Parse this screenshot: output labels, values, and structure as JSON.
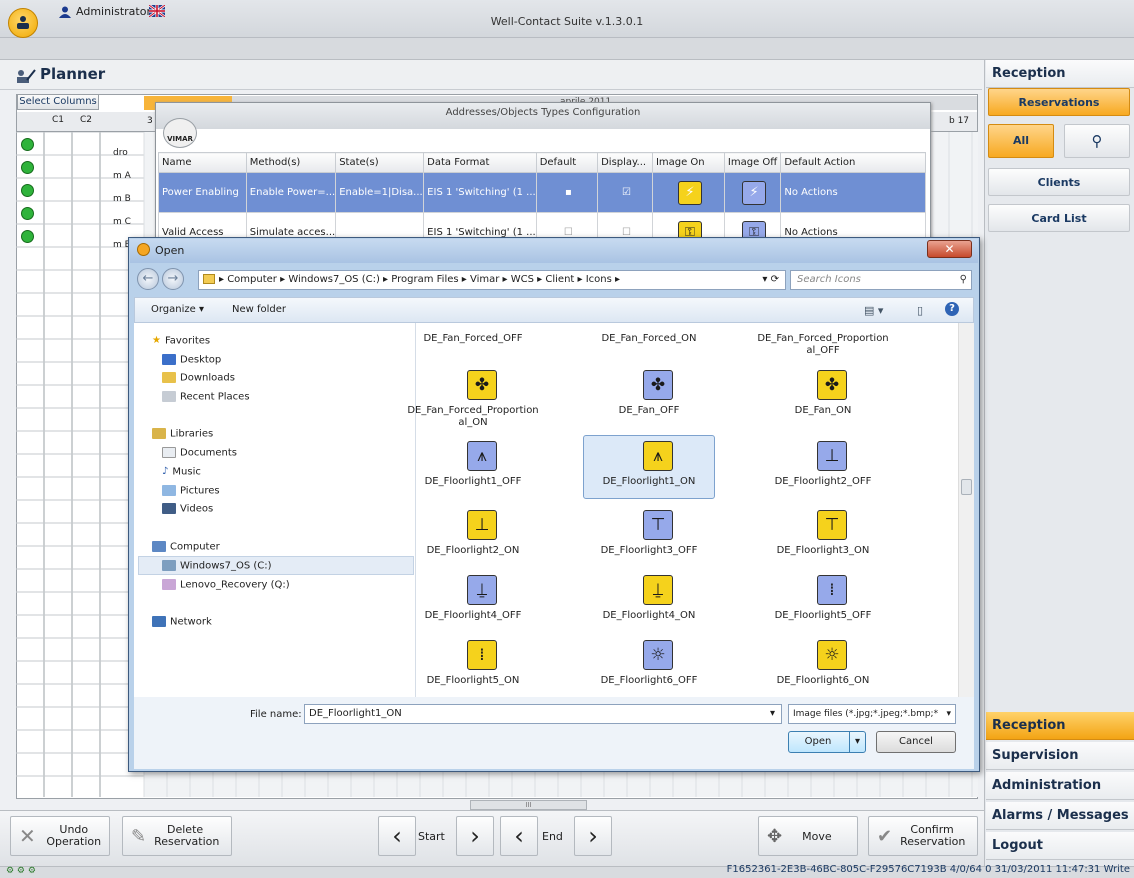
{
  "app": {
    "user": "Administrator",
    "title": "Well-Contact Suite v.1.3.0.1"
  },
  "planner": {
    "title": "Planner",
    "select_columns": "Select Columns",
    "col_c1": "C1",
    "col_c2": "C2",
    "month_right": "aprile 2011",
    "header_3": "3",
    "header_b17": "b 17",
    "rows": [
      "dro",
      "m A",
      "m B",
      "m C",
      "m E"
    ]
  },
  "sidebar": {
    "reception_header": "Reception",
    "reservations": "Reservations",
    "all_icon_label": "All",
    "clients": "Clients",
    "card_list": "Card List",
    "sections": [
      "Reception",
      "Supervision",
      "Administration",
      "Alarms / Messages",
      "Logout"
    ]
  },
  "toolbar": {
    "undo": "Undo Operation",
    "delete": "Delete Reservation",
    "start": "Start",
    "end": "End",
    "move": "Move",
    "confirm": "Confirm Reservation",
    "scroll_glyph": "III"
  },
  "status": "F1652361-2E3B-46BC-805C-F29576C7193B 4/0/64 0 31/03/2011 11:47:31 Write",
  "config_window": {
    "title": "Addresses/Objects Types Configuration",
    "logo": "VIMAR",
    "columns": [
      "Name",
      "Method(s)",
      "State(s)",
      "Data Format",
      "Default",
      "Display...",
      "Image On",
      "Image Off",
      "Default Action"
    ],
    "rows": [
      {
        "name": "Power Enabling",
        "method": "Enable Power=...",
        "state": "Enable=1|Disa...",
        "format": "EIS 1 'Switching' (1 ...",
        "action": "No Actions",
        "on_icon": "⚡",
        "off_icon": "⚡"
      },
      {
        "name": "Valid Access",
        "method": "Simulate acces...",
        "state": "",
        "format": "EIS 1 'Switching' (1 ...",
        "action": "No Actions",
        "on_icon": "⚿",
        "off_icon": "⚿"
      }
    ]
  },
  "dialog": {
    "title": "Open",
    "address": [
      "Computer",
      "Windows7_OS (C:)",
      "Program Files",
      "Vimar",
      "WCS",
      "Client",
      "Icons"
    ],
    "search_placeholder": "Search Icons",
    "organize": "Organize ▾",
    "new_folder": "New folder",
    "nav": {
      "favorites": "Favorites",
      "desktop": "Desktop",
      "downloads": "Downloads",
      "recent": "Recent Places",
      "libraries": "Libraries",
      "documents": "Documents",
      "music": "Music",
      "pictures": "Pictures",
      "videos": "Videos",
      "computer": "Computer",
      "drive_c": "Windows7_OS (C:)",
      "drive_q": "Lenovo_Recovery (Q:)",
      "network": "Network"
    },
    "files": [
      {
        "name": "DE_Fan_Forced_OFF"
      },
      {
        "name": "DE_Fan_Forced_ON"
      },
      {
        "name": "DE_Fan_Forced_Proportional_OFF"
      },
      {
        "name": "DE_Fan_Forced_Proportional_ON",
        "color": "yellow",
        "glyph": "✤"
      },
      {
        "name": "DE_Fan_OFF",
        "color": "blue",
        "glyph": "✤"
      },
      {
        "name": "DE_Fan_ON",
        "color": "yellow",
        "glyph": "✤"
      },
      {
        "name": "DE_Floorlight1_OFF",
        "color": "blue",
        "glyph": "⩚"
      },
      {
        "name": "DE_Floorlight1_ON",
        "color": "yellow",
        "glyph": "⩚",
        "selected": true
      },
      {
        "name": "DE_Floorlight2_OFF",
        "color": "blue",
        "glyph": "⊥"
      },
      {
        "name": "DE_Floorlight2_ON",
        "color": "yellow",
        "glyph": "⊥"
      },
      {
        "name": "DE_Floorlight3_OFF",
        "color": "blue",
        "glyph": "⊤"
      },
      {
        "name": "DE_Floorlight3_ON",
        "color": "yellow",
        "glyph": "⊤"
      },
      {
        "name": "DE_Floorlight4_OFF",
        "color": "blue",
        "glyph": "⍊"
      },
      {
        "name": "DE_Floorlight4_ON",
        "color": "yellow",
        "glyph": "⍊"
      },
      {
        "name": "DE_Floorlight5_OFF",
        "color": "blue",
        "glyph": "⁞"
      },
      {
        "name": "DE_Floorlight5_ON",
        "color": "yellow",
        "glyph": "⁞"
      },
      {
        "name": "DE_Floorlight6_OFF",
        "color": "blue",
        "glyph": "☼"
      },
      {
        "name": "DE_Floorlight6_ON",
        "color": "yellow",
        "glyph": "☼"
      }
    ],
    "filename_label": "File name:",
    "filename_value": "DE_Floorlight1_ON",
    "filetype": "Image files (*.jpg;*.jpeg;*.bmp;*",
    "open": "Open",
    "cancel": "Cancel"
  },
  "colors": {
    "accent_orange": "#f7b43a",
    "selection_blue": "#6f8fd3",
    "icon_yellow": "#f5d21c",
    "icon_blue": "#96a9ea"
  }
}
